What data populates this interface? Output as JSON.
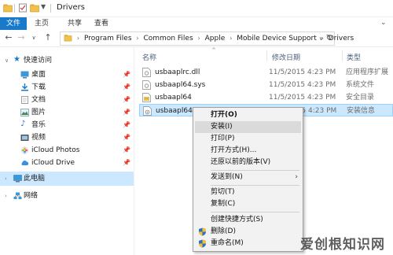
{
  "window": {
    "title": "Drivers"
  },
  "ribbon": {
    "tabs": [
      "文件",
      "主页",
      "共享",
      "查看"
    ]
  },
  "address": {
    "crumbs": [
      "Program Files",
      "Common Files",
      "Apple",
      "Mobile Device Support",
      "Drivers"
    ]
  },
  "nav": {
    "quick_access": "快速访问",
    "items": [
      "桌面",
      "下载",
      "文档",
      "图片",
      "音乐",
      "视频",
      "iCloud Photos",
      "iCloud Drive"
    ],
    "this_pc": "此电脑",
    "network": "网络"
  },
  "columns": {
    "name": "名称",
    "date": "修改日期",
    "type": "类型"
  },
  "files": [
    {
      "name": "usbaaplrc.dll",
      "date": "11/5/2015 4:23 PM",
      "type": "应用程序扩展"
    },
    {
      "name": "usbaapl64.sys",
      "date": "11/5/2015 4:23 PM",
      "type": "系统文件"
    },
    {
      "name": "usbaapl64",
      "date": "11/5/2015 4:23 PM",
      "type": "安全目录"
    },
    {
      "name": "usbaapl64",
      "date": "11/5/2015 4:23 PM",
      "type": "安装信息"
    }
  ],
  "context_menu": [
    "打开(O)",
    "安装(I)",
    "打印(P)",
    "打开方式(H)...",
    "还原以前的版本(V)",
    "发送到(N)",
    "剪切(T)",
    "复制(C)",
    "创建快捷方式(S)",
    "删除(D)",
    "重命名(M)"
  ],
  "watermark": "爱创根知识网",
  "colors": {
    "accent": "#1979ca",
    "selection": "#cce8ff",
    "folder": "#f0c14b"
  }
}
